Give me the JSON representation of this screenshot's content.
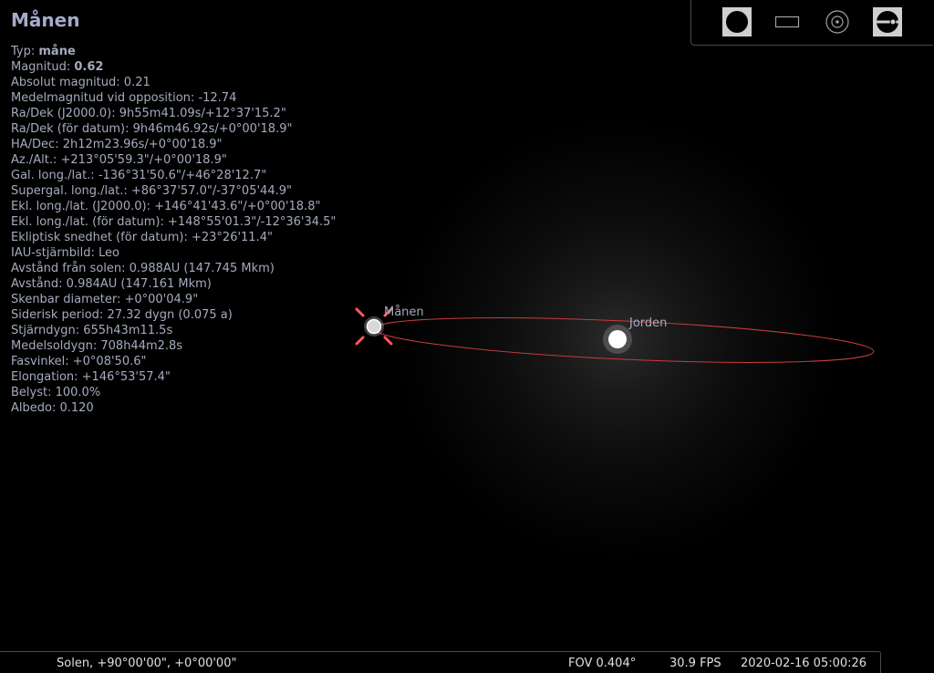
{
  "info": {
    "title": "Månen",
    "rows": [
      {
        "label": "Typ: ",
        "value": "måne",
        "bold": true
      },
      {
        "label": "Magnitud: ",
        "value": "0.62",
        "bold": true
      },
      {
        "label": "Absolut magnitud: ",
        "value": "0.21"
      },
      {
        "label": "Medelmagnitud vid opposition: ",
        "value": "-12.74"
      },
      {
        "label": "Ra/Dek (J2000.0): ",
        "value": "9h55m41.09s/+12°37'15.2\""
      },
      {
        "label": "Ra/Dek (för datum): ",
        "value": "9h46m46.92s/+0°00'18.9\""
      },
      {
        "label": "HA/Dec: ",
        "value": "2h12m23.96s/+0°00'18.9\""
      },
      {
        "label": "Az./Alt.: ",
        "value": "+213°05'59.3\"/+0°00'18.9\""
      },
      {
        "label": "Gal. long./lat.: ",
        "value": "-136°31'50.6\"/+46°28'12.7\""
      },
      {
        "label": "Supergal. long./lat.: ",
        "value": "+86°37'57.0\"/-37°05'44.9\""
      },
      {
        "label": "Ekl. long./lat. (J2000.0): ",
        "value": "+146°41'43.6\"/+0°00'18.8\""
      },
      {
        "label": "Ekl. long./lat. (för datum): ",
        "value": "+148°55'01.3\"/-12°36'34.5\""
      },
      {
        "label": "Ekliptisk snedhet (för datum): ",
        "value": "+23°26'11.4\""
      },
      {
        "label": "IAU-stjärnbild: ",
        "value": "Leo"
      },
      {
        "label": "Avstånd från solen: ",
        "value": "0.988AU (147.745 Mkm)"
      },
      {
        "label": "Avstånd: ",
        "value": "0.984AU (147.161 Mkm)"
      },
      {
        "label": "Skenbar diameter: ",
        "value": "+0°00'04.9\""
      },
      {
        "label": "Siderisk period: ",
        "value": "27.32 dygn (0.075 a)"
      },
      {
        "label": "Stjärndygn: ",
        "value": "655h43m11.5s"
      },
      {
        "label": "Medelsoldygn: ",
        "value": "708h44m2.8s"
      },
      {
        "label": "Fasvinkel: ",
        "value": "+0°08'50.6\""
      },
      {
        "label": "Elongation: ",
        "value": "+146°53'57.4\""
      },
      {
        "label": "Belyst: ",
        "value": "100.0%"
      },
      {
        "label": "Albedo: ",
        "value": "0.120"
      }
    ]
  },
  "sky": {
    "moon_label": "Månen",
    "earth_label": "Jorden",
    "orbit_color": "#c83c3c",
    "marker_color": "#ff5a5a",
    "marker_shape": "crosshair-brackets"
  },
  "toolbar": {
    "buttons": [
      {
        "name": "planet-view-button",
        "icon": "filled-circle-icon",
        "active": true
      },
      {
        "name": "rectangle-view-button",
        "icon": "rectangle-icon",
        "active": false
      },
      {
        "name": "target-view-button",
        "icon": "target-icon",
        "active": false
      },
      {
        "name": "horizon-view-button",
        "icon": "horizon-icon",
        "active": true
      }
    ]
  },
  "status": {
    "location": "Solen, +90°00'00\", +0°00'00\"",
    "fov": "FOV 0.404°",
    "fps": "30.9 FPS",
    "datetime": "2020-02-16 05:00:26"
  }
}
